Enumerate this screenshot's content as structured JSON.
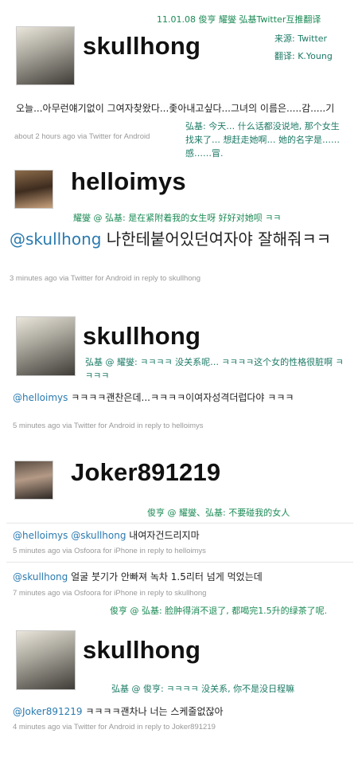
{
  "header": {
    "credit_line": "11.01.08 俊亨 耀燮 弘基Twitter互推翻译",
    "source": "来源: Twitter",
    "translator": "翻译: K.Young"
  },
  "tweets": [
    {
      "username": "skullhong",
      "text": "오늘...아무런얘기없이 그여자찾왔다...좇아내고싶다...그녀의 이름은.....감.....기",
      "meta": "about 2 hours ago via Twitter for Android",
      "translation": "弘基: 今天… 什么话都没说地, 那个女生找来了… 想赶走她啊… 她的名字是……感……冒."
    },
    {
      "username": "helloimys",
      "translation": "耀燮 @ 弘基: 是在紧附着我的女生呀 好好对她呗 ㅋㅋ",
      "mention": "@skullhong",
      "text": " 나한테붙어있던여자야 잘해줘ㅋㅋ",
      "meta": "3 minutes ago via Twitter for Android in reply to skullhong"
    },
    {
      "username": "skullhong",
      "translation": "弘基 @ 耀燮: ㅋㅋㅋㅋ 没关系呢… ㅋㅋㅋㅋ这个女的性格很脏啊 ㅋㅋㅋㅋ",
      "mention": "@helloimys",
      "text": " ㅋㅋㅋㅋ괜찬은데...ㅋㅋㅋㅋ이여자성격더럽다야 ㅋㅋㅋ",
      "meta": "5 minutes ago via Twitter for Android in reply to helloimys"
    },
    {
      "username": "Joker891219",
      "translation": "俊亨 @ 耀燮、弘基: 不要碰我的女人",
      "mention1": "@helloimys",
      "mention2": "@skullhong",
      "text": " 내여자건드리지마",
      "meta": "5 minutes ago via Osfoora for iPhone in reply to helloimys"
    },
    {
      "mention": "@skullhong",
      "text": " 얼굴 붓기가 안빠져 녹차 1.5리터 넘게 먹었는데",
      "meta": "7 minutes ago via Osfoora for iPhone in reply to skullhong",
      "translation": "俊亨 @ 弘基: 脸肿得消不退了, 都喝完1.5升的绿茶了呢."
    },
    {
      "username": "skullhong",
      "translation": "弘基 @ 俊亨: ㅋㅋㅋㅋ 没关系, 你不是没日程嘛",
      "mention": "@Joker891219",
      "text": " ㅋㅋㅋㅋ괜차나 너는 스케줄없잖아",
      "meta": "4 minutes ago via Twitter for Android in reply to Joker891219"
    }
  ]
}
